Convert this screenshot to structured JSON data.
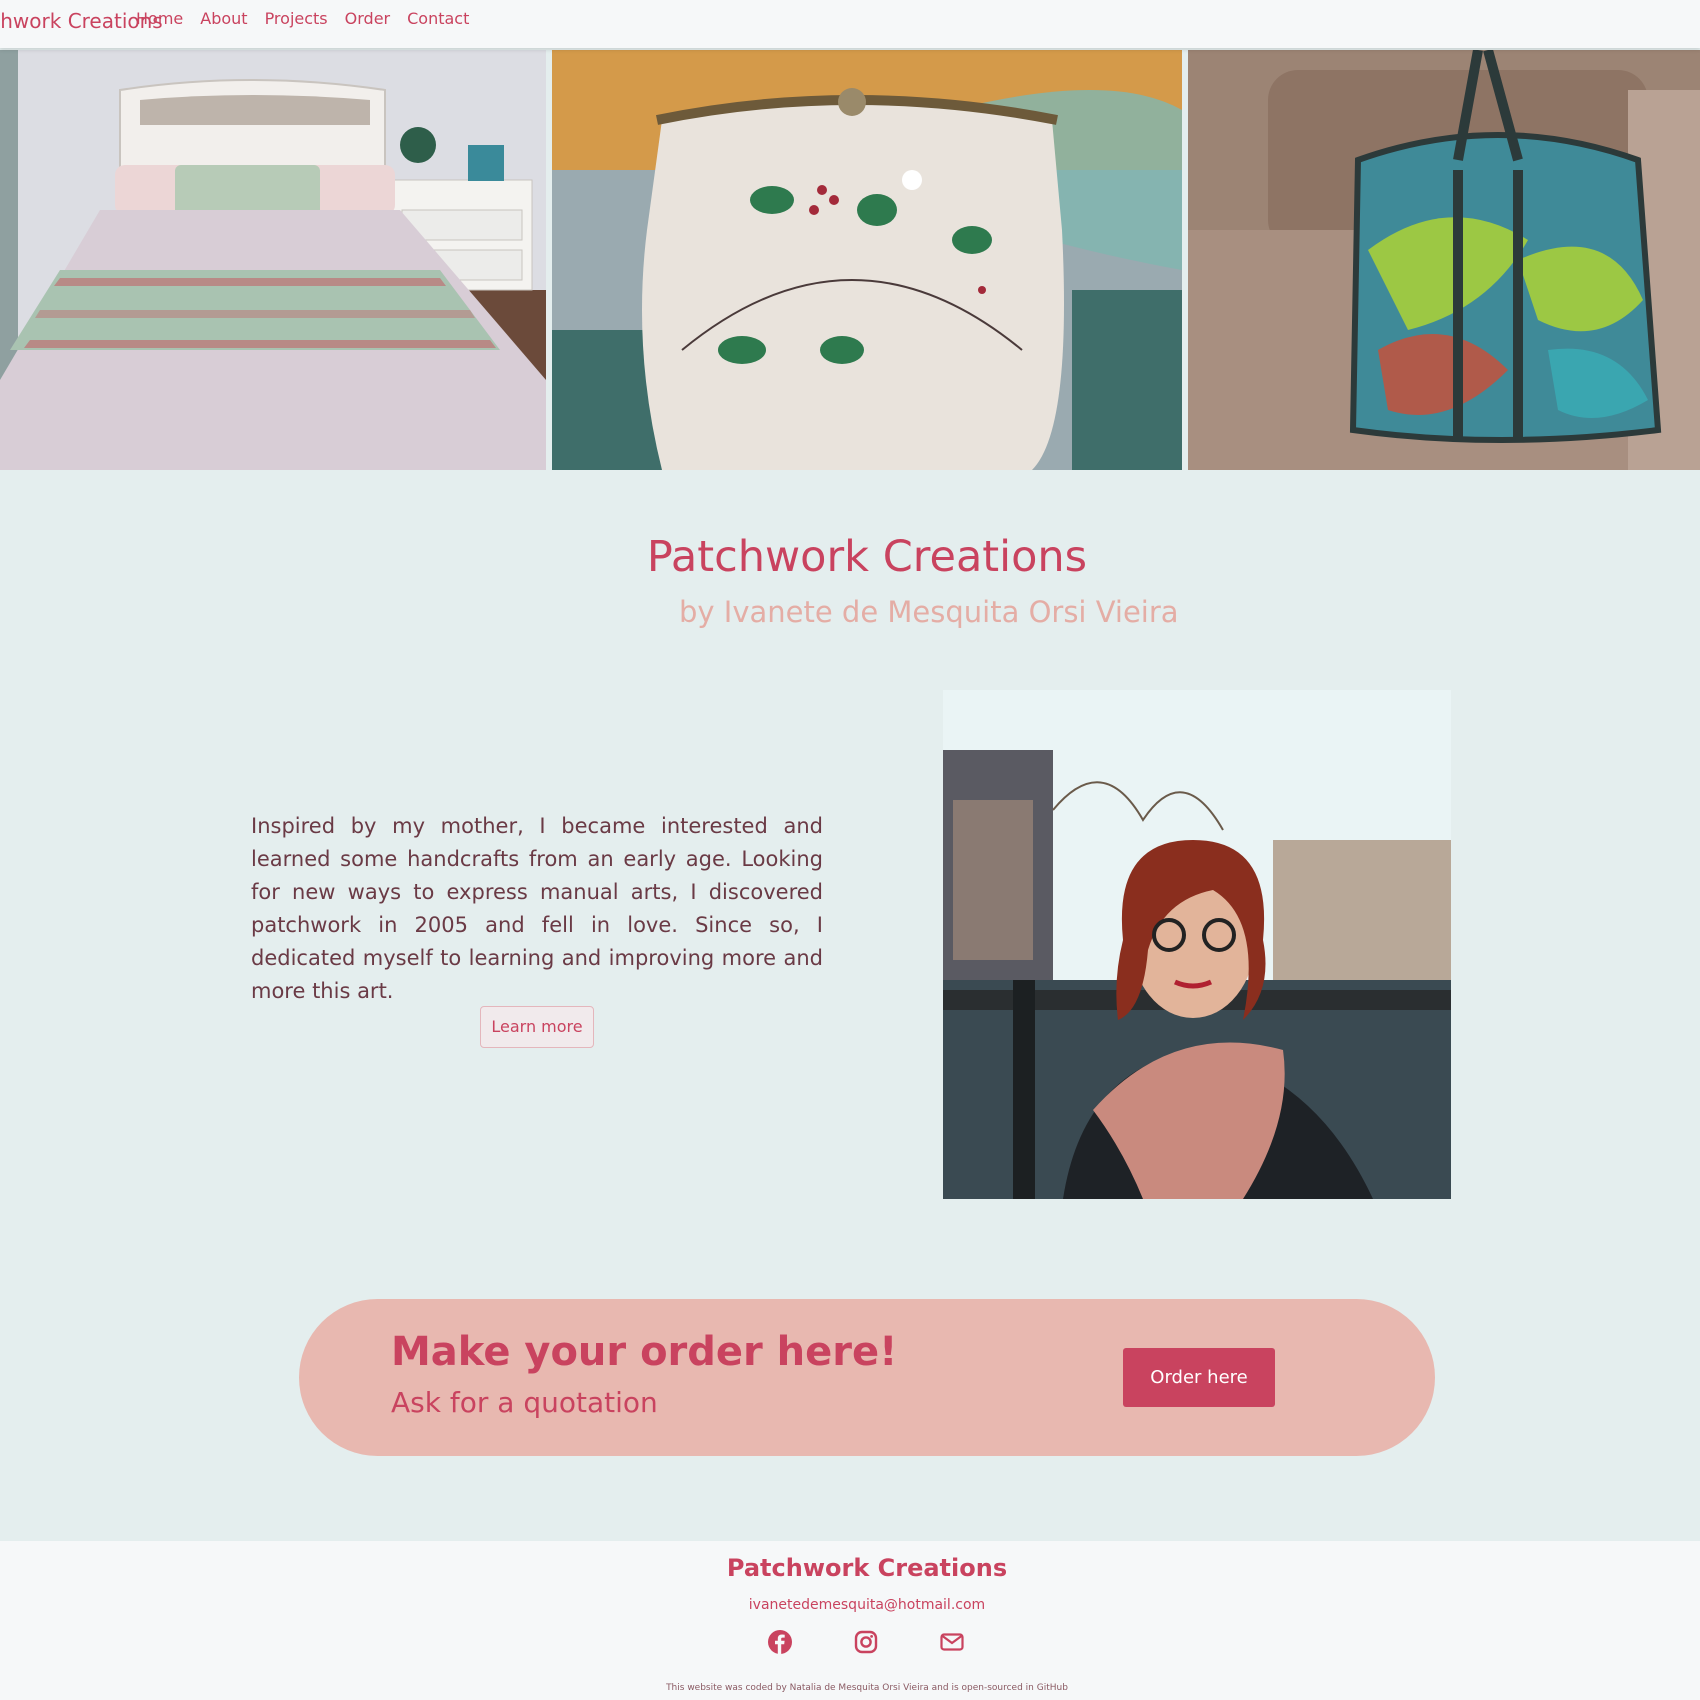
{
  "navbar": {
    "brand": "Patchwork Creations",
    "links": [
      "Home",
      "About",
      "Projects",
      "Order",
      "Contact"
    ]
  },
  "hero": {
    "images": [
      "bedspread-photo",
      "embroidered-purse-photo",
      "patchwork-bag-photo"
    ]
  },
  "intro": {
    "title": "Patchwork Creations",
    "subtitle": "by Ivanete de Mesquita Orsi Vieira"
  },
  "about": {
    "text": "Inspired by my mother, I became interested and learned some handcrafts from an early age. Looking for new ways to express manual arts, I discovered patchwork in 2005 and fell in love. Since so, I dedicated myself to learning and improving more and more this art.",
    "button_label": "Learn more"
  },
  "order": {
    "title": "Make your order here!",
    "subtitle": "Ask for a quotation",
    "button_label": "Order here"
  },
  "footer": {
    "title": "Patchwork Creations",
    "email": "ivanetedemesquita@hotmail.com",
    "icons": [
      "facebook-icon",
      "instagram-icon",
      "envelope-icon"
    ],
    "note": "This website was coded by Natalia de Mesquita Orsi Vieira and is open-sourced in GitHub"
  },
  "colors": {
    "accent": "#c9435f",
    "subtitle": "#e4ada5",
    "background": "#e4eeee",
    "banner": "#e8b8b0",
    "navbar": "#f6f8f9"
  }
}
